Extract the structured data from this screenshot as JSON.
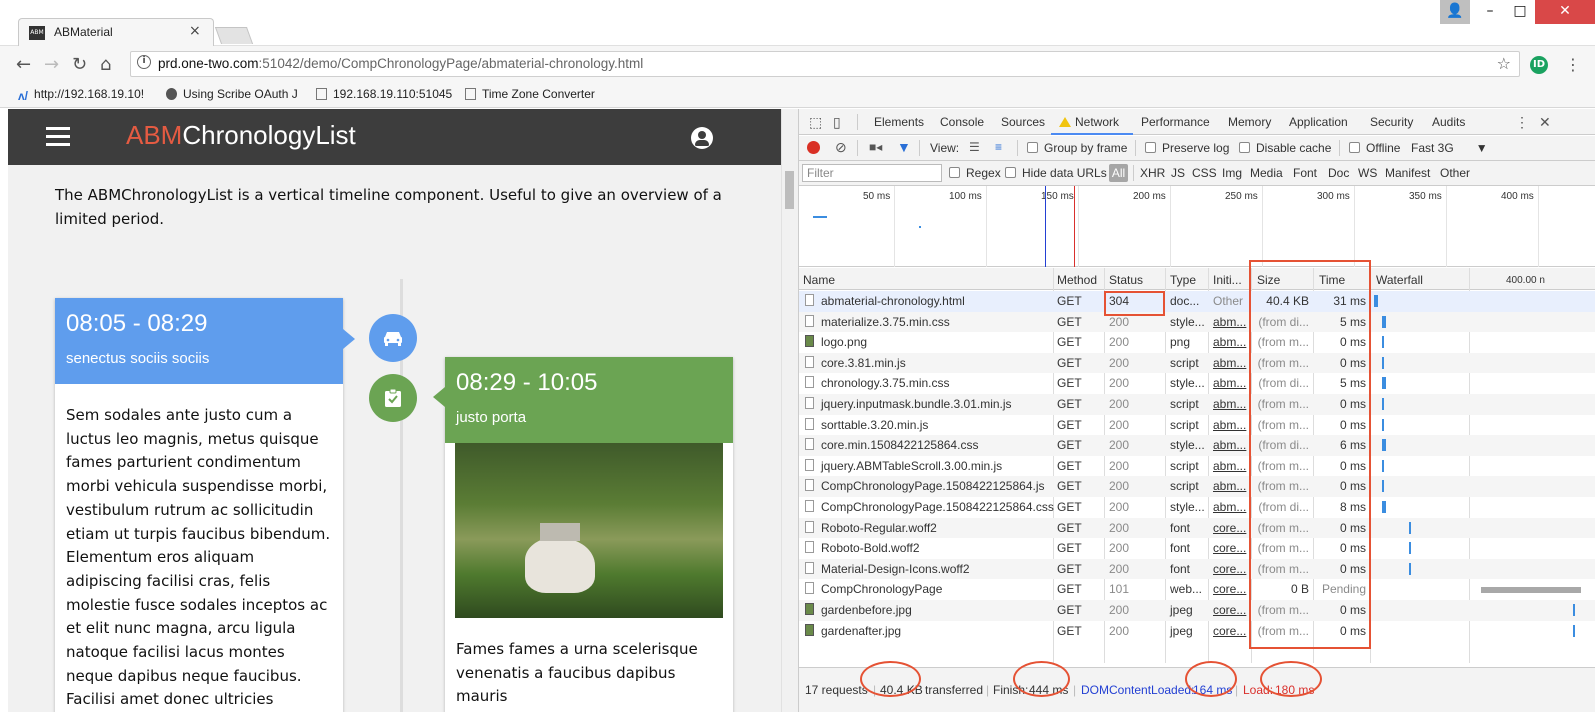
{
  "browser": {
    "tab_title": "ABMaterial",
    "tab_favicon": "ABM",
    "url_host": "prd.one-two.com",
    "url_path": ":51042/demo/CompChronologyPage/abmaterial-chronology.html",
    "extension_initials": "ID",
    "bookmarks": [
      {
        "label": "http://192.168.19.10!",
        "icon": "bookmark-site-icon"
      },
      {
        "label": "Using Scribe OAuth J",
        "icon": "bookmark-person-icon"
      },
      {
        "label": "192.168.19.110:51045",
        "icon": "page-icon"
      },
      {
        "label": "Time Zone Converter",
        "icon": "page-icon"
      }
    ]
  },
  "page": {
    "app_title_prefix": "ABM",
    "app_title_rest": "ChronologyList",
    "intro": "The ABMChronologyList is a vertical timeline component. Useful to give an overview of a limited period.",
    "cards": [
      {
        "time": "08:05 - 08:29",
        "subtitle": "senectus sociis sociis",
        "color": "#5f9ded",
        "icon": "car-icon",
        "body": "Sem sodales ante justo cum a luctus leo magnis, metus quisque fames parturient condimentum morbi vehicula suspendisse morbi, vestibulum rutrum ac sollicitudin etiam ut turpis faucibus bibendum. Elementum eros aliquam adipiscing facilisi cras, felis molestie fusce sodales inceptos ac et elit nunc magna, arcu ligula natoque facilisi lacus montes neque dapibus neque faucibus. Facilisi amet donec ultricies"
      },
      {
        "time": "08:29 - 10:05",
        "subtitle": "justo porta",
        "color": "#6ba453",
        "icon": "assignment-check-icon",
        "body": "Fames fames a urna scelerisque venenatis a faucibus dapibus mauris"
      }
    ]
  },
  "devtools": {
    "tabs": [
      "Elements",
      "Console",
      "Sources",
      "Network",
      "Performance",
      "Memory",
      "Application",
      "Security",
      "Audits"
    ],
    "active_tab": "Network",
    "toolbar": {
      "view_label": "View:",
      "group_by_frame": "Group by frame",
      "preserve_log": "Preserve log",
      "disable_cache": "Disable cache",
      "offline": "Offline",
      "throttle": "Fast 3G"
    },
    "filter": {
      "placeholder": "Filter",
      "regex": "Regex",
      "hide_data_urls": "Hide data URLs",
      "types": [
        "All",
        "XHR",
        "JS",
        "CSS",
        "Img",
        "Media",
        "Font",
        "Doc",
        "WS",
        "Manifest",
        "Other"
      ]
    },
    "overview_ticks": [
      "50 ms",
      "100 ms",
      "150 ms",
      "200 ms",
      "250 ms",
      "300 ms",
      "350 ms",
      "400 ms"
    ],
    "columns": {
      "name": "Name",
      "method": "Method",
      "status": "Status",
      "type": "Type",
      "initiator": "Initi...",
      "size": "Size",
      "time": "Time",
      "waterfall": "Waterfall",
      "waterfall_scale": "400.00 n"
    },
    "requests": [
      {
        "name": "abmaterial-chronology.html",
        "method": "GET",
        "status": "304",
        "type": "doc...",
        "initiator": "Other",
        "size": "40.4 KB",
        "time": "31 ms",
        "icon": "document-icon",
        "wf_offset": 0.01,
        "wf_color": "#3b8de0"
      },
      {
        "name": "materialize.3.75.min.css",
        "method": "GET",
        "status": "200",
        "type": "style...",
        "initiator": "abm...",
        "size": "(from di...",
        "time": "5 ms",
        "icon": "document-icon",
        "wf_offset": 0.05,
        "wf_color": "#3b8de0"
      },
      {
        "name": "logo.png",
        "method": "GET",
        "status": "200",
        "type": "png",
        "initiator": "abm...",
        "size": "(from m...",
        "time": "0 ms",
        "icon": "image-icon",
        "wf_offset": 0.05,
        "wf_color": "#3b8de0"
      },
      {
        "name": "core.3.81.min.js",
        "method": "GET",
        "status": "200",
        "type": "script",
        "initiator": "abm...",
        "size": "(from m...",
        "time": "0 ms",
        "icon": "document-icon",
        "wf_offset": 0.05,
        "wf_color": "#3b8de0"
      },
      {
        "name": "chronology.3.75.min.css",
        "method": "GET",
        "status": "200",
        "type": "style...",
        "initiator": "abm...",
        "size": "(from di...",
        "time": "5 ms",
        "icon": "document-icon",
        "wf_offset": 0.05,
        "wf_color": "#3b8de0"
      },
      {
        "name": "jquery.inputmask.bundle.3.01.min.js",
        "method": "GET",
        "status": "200",
        "type": "script",
        "initiator": "abm...",
        "size": "(from m...",
        "time": "0 ms",
        "icon": "document-icon",
        "wf_offset": 0.05,
        "wf_color": "#3b8de0"
      },
      {
        "name": "sorttable.3.20.min.js",
        "method": "GET",
        "status": "200",
        "type": "script",
        "initiator": "abm...",
        "size": "(from m...",
        "time": "0 ms",
        "icon": "document-icon",
        "wf_offset": 0.05,
        "wf_color": "#3b8de0"
      },
      {
        "name": "core.min.1508422125864.css",
        "method": "GET",
        "status": "200",
        "type": "style...",
        "initiator": "abm...",
        "size": "(from di...",
        "time": "6 ms",
        "icon": "document-icon",
        "wf_offset": 0.05,
        "wf_color": "#3b8de0"
      },
      {
        "name": "jquery.ABMTableScroll.3.00.min.js",
        "method": "GET",
        "status": "200",
        "type": "script",
        "initiator": "abm...",
        "size": "(from m...",
        "time": "0 ms",
        "icon": "document-icon",
        "wf_offset": 0.05,
        "wf_color": "#3b8de0"
      },
      {
        "name": "CompChronologyPage.1508422125864.js",
        "method": "GET",
        "status": "200",
        "type": "script",
        "initiator": "abm...",
        "size": "(from m...",
        "time": "0 ms",
        "icon": "document-icon",
        "wf_offset": 0.05,
        "wf_color": "#3b8de0"
      },
      {
        "name": "CompChronologyPage.1508422125864.css",
        "method": "GET",
        "status": "200",
        "type": "style...",
        "initiator": "abm...",
        "size": "(from di...",
        "time": "8 ms",
        "icon": "document-icon",
        "wf_offset": 0.05,
        "wf_color": "#3b8de0"
      },
      {
        "name": "Roboto-Regular.woff2",
        "method": "GET",
        "status": "200",
        "type": "font",
        "initiator": "core...",
        "size": "(from m...",
        "time": "0 ms",
        "icon": "document-icon",
        "wf_offset": 0.18,
        "wf_color": "#3b8de0"
      },
      {
        "name": "Roboto-Bold.woff2",
        "method": "GET",
        "status": "200",
        "type": "font",
        "initiator": "core...",
        "size": "(from m...",
        "time": "0 ms",
        "icon": "document-icon",
        "wf_offset": 0.18,
        "wf_color": "#3b8de0"
      },
      {
        "name": "Material-Design-Icons.woff2",
        "method": "GET",
        "status": "200",
        "type": "font",
        "initiator": "core...",
        "size": "(from m...",
        "time": "0 ms",
        "icon": "document-icon",
        "wf_offset": 0.18,
        "wf_color": "#3b8de0"
      },
      {
        "name": "CompChronologyPage",
        "method": "GET",
        "status": "101",
        "type": "web...",
        "initiator": "core...",
        "size": "0 B",
        "time": "Pending",
        "icon": "document-icon",
        "wf_offset": 0.62,
        "wf_color": "#a0a0a0"
      },
      {
        "name": "gardenbefore.jpg",
        "method": "GET",
        "status": "200",
        "type": "jpeg",
        "initiator": "core...",
        "size": "(from m...",
        "time": "0 ms",
        "icon": "image-icon",
        "wf_offset": 0.98,
        "wf_color": "#3b8de0"
      },
      {
        "name": "gardenafter.jpg",
        "method": "GET",
        "status": "200",
        "type": "jpeg",
        "initiator": "core...",
        "size": "(from m...",
        "time": "0 ms",
        "icon": "image-icon",
        "wf_offset": 0.98,
        "wf_color": "#3b8de0"
      }
    ],
    "status": {
      "requests": "17 requests",
      "transferred_value": "40.4 KB",
      "transferred_label": "transferred",
      "finish_label": "Finish:",
      "finish_value": "444 ms",
      "dcl_label": "DOMContentLoaded:",
      "dcl_value": "164 ms",
      "load_label": "Load:",
      "load_value": "180 ms"
    },
    "colors": {
      "dcl": "#2340d3",
      "load": "#d9302c",
      "annotation": "#e55234"
    }
  }
}
